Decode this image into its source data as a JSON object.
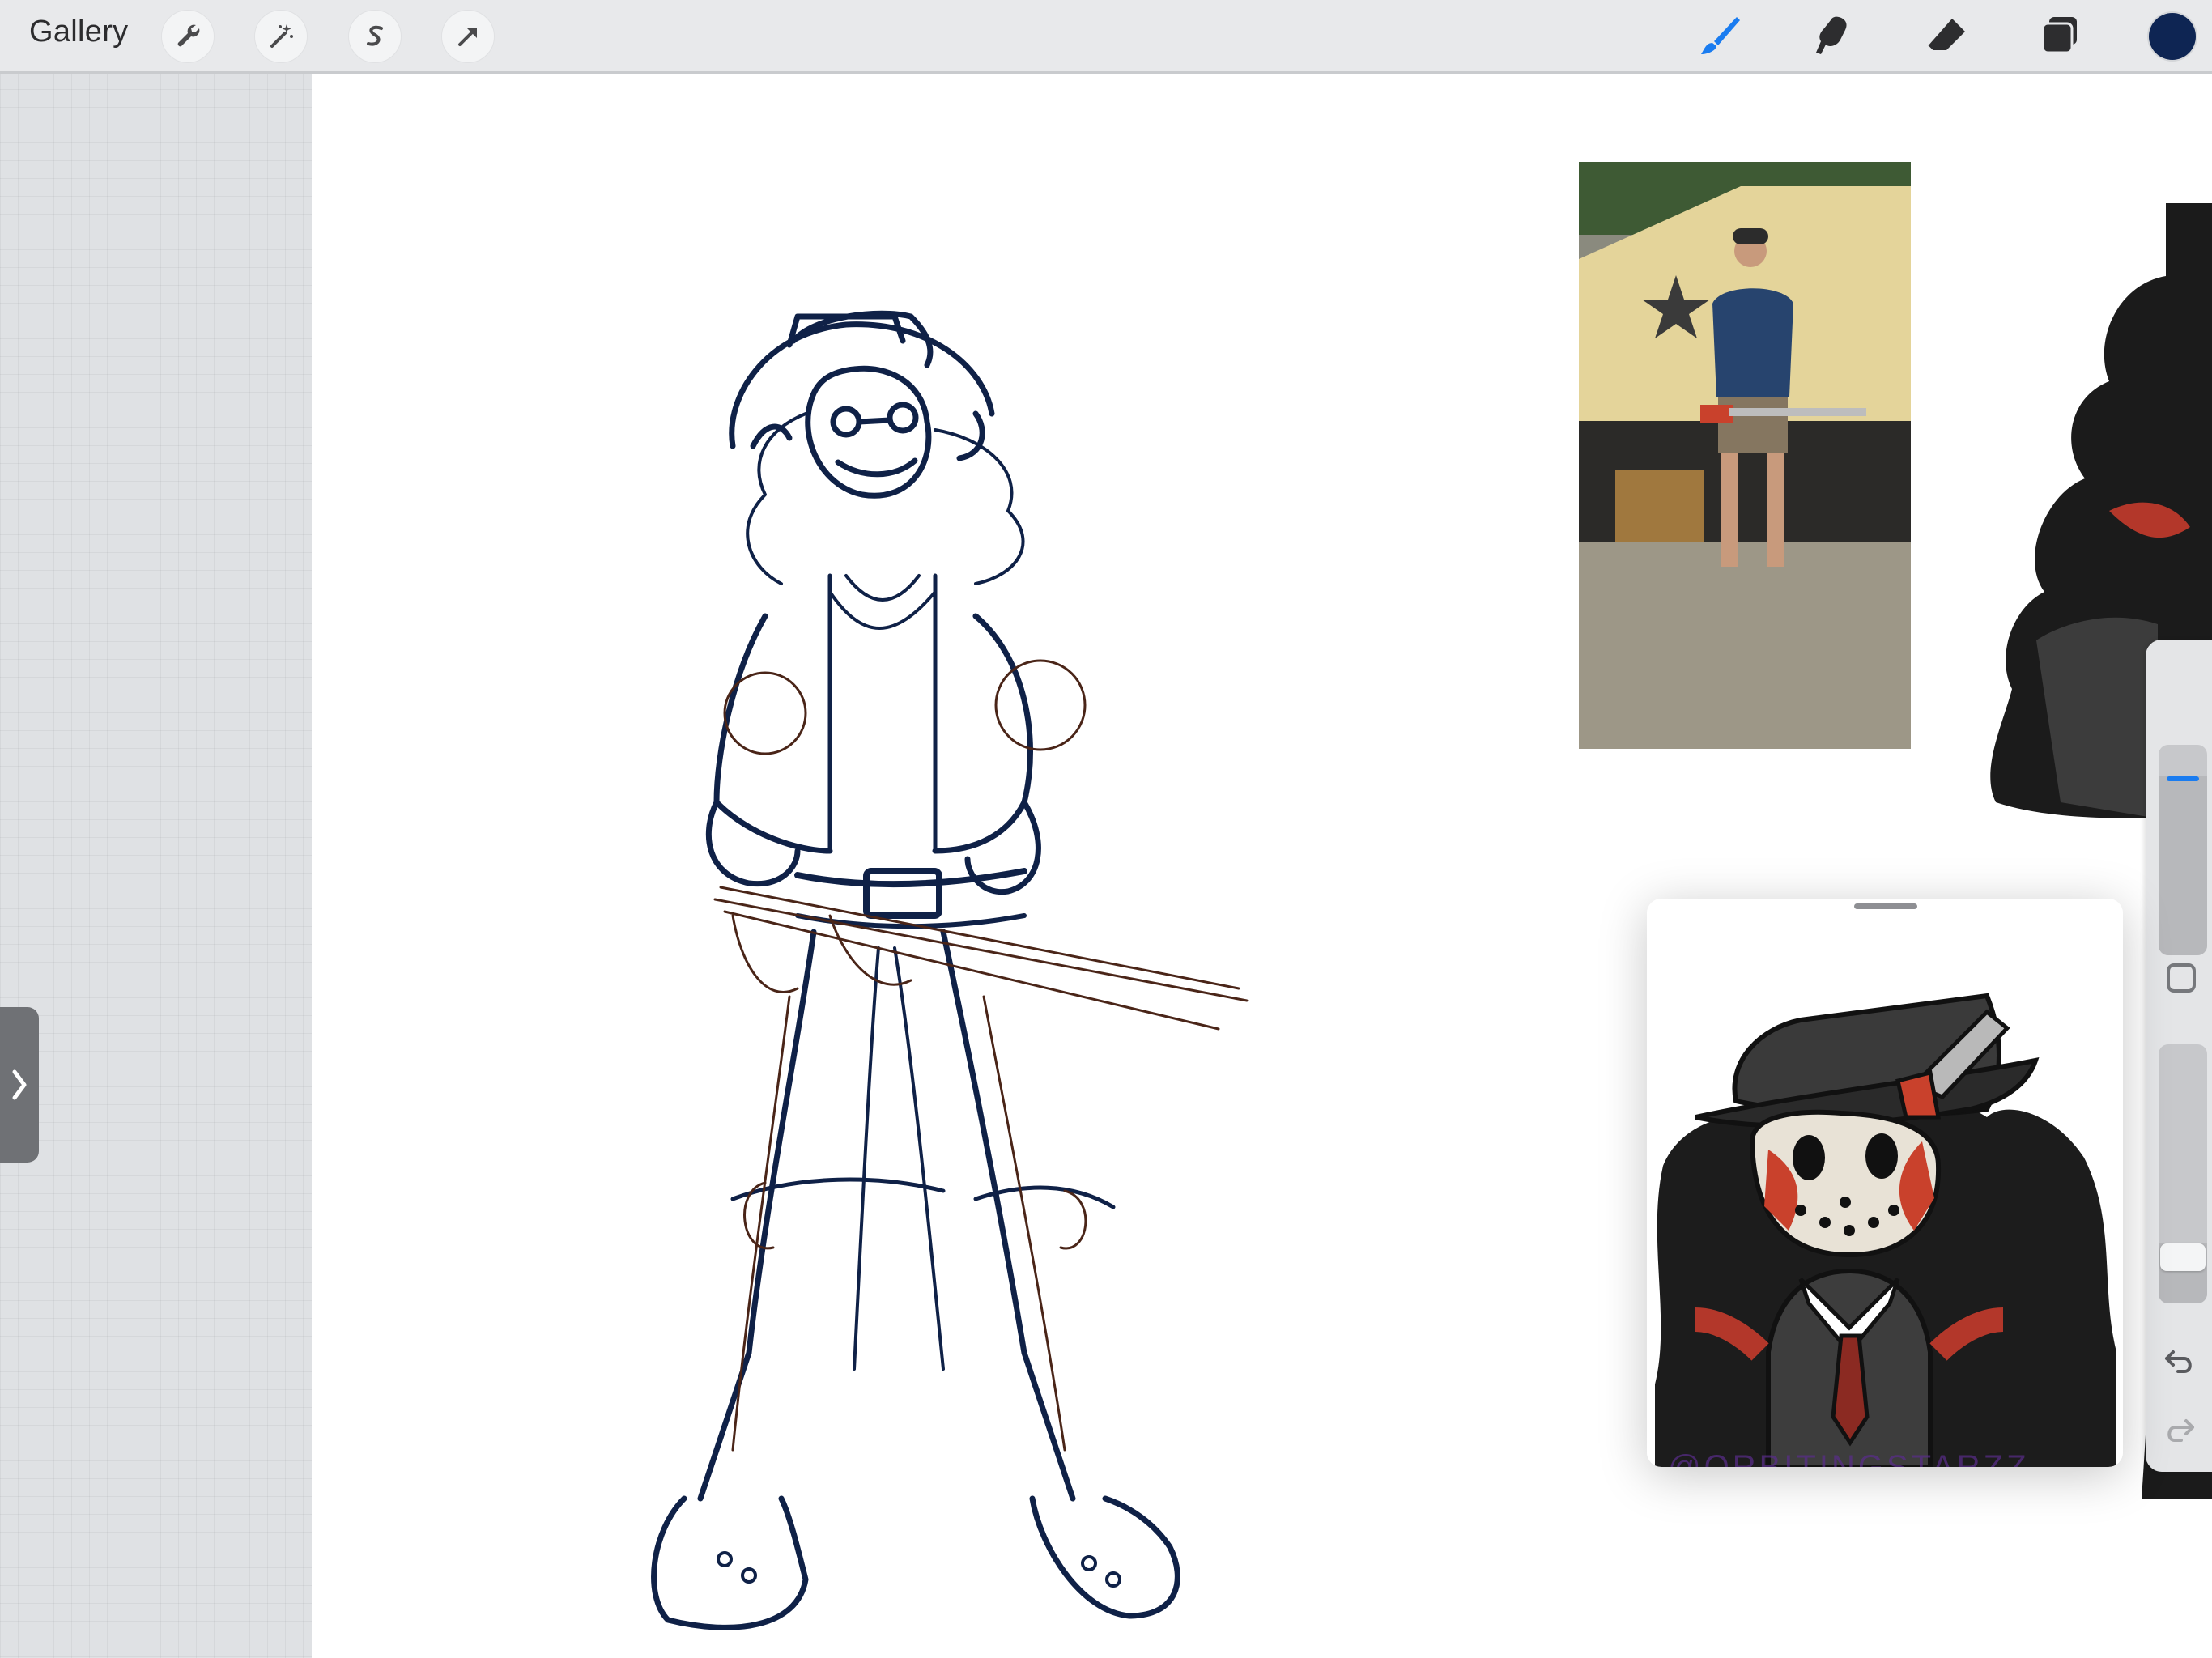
{
  "toolbar": {
    "gallery_label": "Gallery",
    "left_tools": [
      {
        "name": "Actions",
        "icon": "wrench-icon"
      },
      {
        "name": "Adjustments",
        "icon": "magic-wand-icon"
      },
      {
        "name": "Selection",
        "icon": "selection-icon"
      },
      {
        "name": "Transform",
        "icon": "transform-arrow-icon"
      }
    ],
    "right_tools": [
      {
        "name": "Brush",
        "icon": "brush-icon",
        "active": true
      },
      {
        "name": "Smudge",
        "icon": "smudge-icon",
        "active": false
      },
      {
        "name": "Eraser",
        "icon": "eraser-icon",
        "active": false
      },
      {
        "name": "Layers",
        "icon": "layers-icon",
        "active": false
      }
    ],
    "current_color": "#0e2553",
    "active_tool_color": "#1a7cf0"
  },
  "sidebar": {
    "brush_size": 0.85,
    "brush_opacity": 0.23,
    "modify_icon": "square-icon",
    "undo_icon": "undo-arrow-icon",
    "redo_icon": "redo-arrow-icon"
  },
  "reference_window": {
    "watermark": "@ORBITINGSTARZZ"
  },
  "colors": {
    "sketch_blue": "#0f2147",
    "sketch_brown": "#4a2518",
    "ref_red": "#c9412c",
    "ref_dark": "#3a3a3a"
  }
}
